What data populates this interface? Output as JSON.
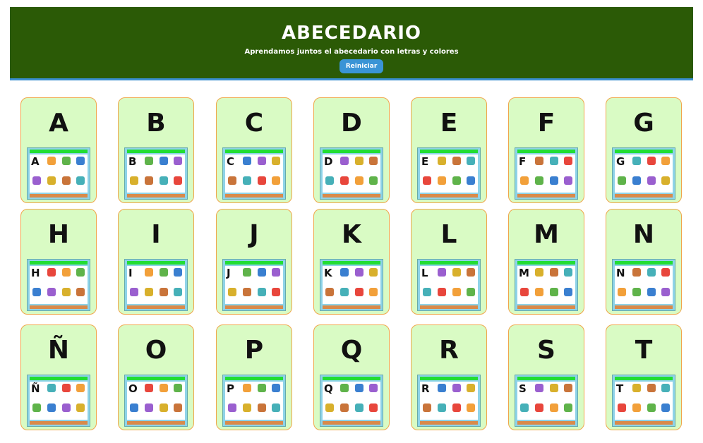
{
  "header": {
    "title": "ABECEDARIO",
    "subtitle": "Aprendamos juntos el abecedario con letras y colores",
    "reset_label": "Reiniciar"
  },
  "cards": [
    {
      "letter": "A"
    },
    {
      "letter": "B"
    },
    {
      "letter": "C"
    },
    {
      "letter": "D"
    },
    {
      "letter": "E"
    },
    {
      "letter": "F"
    },
    {
      "letter": "G"
    },
    {
      "letter": "H"
    },
    {
      "letter": "I"
    },
    {
      "letter": "J"
    },
    {
      "letter": "K"
    },
    {
      "letter": "L"
    },
    {
      "letter": "M"
    },
    {
      "letter": "N"
    },
    {
      "letter": "Ñ"
    },
    {
      "letter": "O"
    },
    {
      "letter": "P"
    },
    {
      "letter": "Q"
    },
    {
      "letter": "R"
    },
    {
      "letter": "S"
    },
    {
      "letter": "T"
    }
  ],
  "colors": {
    "header_bg": "#2b5a06",
    "card_bg": "#d9fbc4",
    "card_border": "#f0a64a",
    "button": "#3a94d6"
  }
}
